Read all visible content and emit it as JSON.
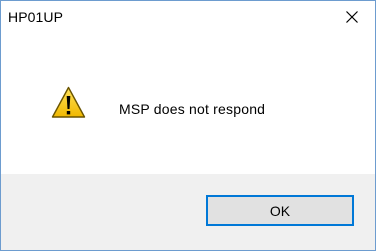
{
  "window": {
    "title": "HP01UP",
    "close_icon": "close-icon"
  },
  "dialog": {
    "icon": "warning-icon",
    "message": "MSP does not respond"
  },
  "buttons": {
    "ok_label": "OK"
  },
  "colors": {
    "window_border": "#6d9ccf",
    "footer_background": "#f0f0f0",
    "button_accent": "#0078d7",
    "warning_yellow": "#f4c400"
  }
}
